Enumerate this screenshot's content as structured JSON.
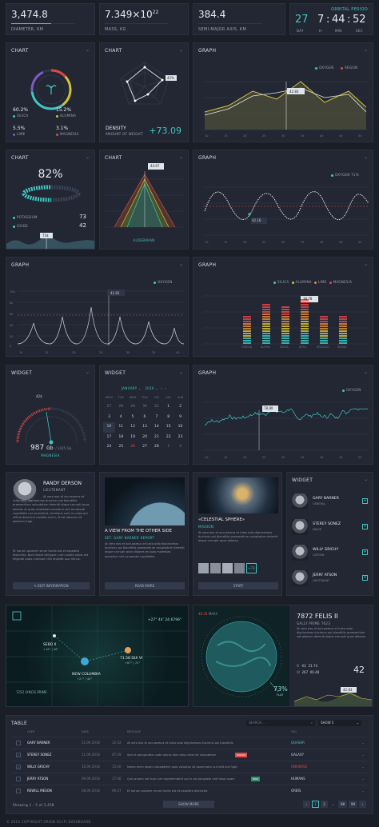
{
  "stats": [
    {
      "value": "3,474.8",
      "label": "DIAMETER, KM"
    },
    {
      "value": "7.349×10",
      "exp": "22",
      "label": "MASS, KG"
    },
    {
      "value": "384.4",
      "label": "SEMI-MAJOR AXIS, KM"
    }
  ],
  "orbital": {
    "title": "ORBITAL PERIOD",
    "d": "27",
    "h": "7",
    "m": "44",
    "s": "52",
    "dl": "DAY",
    "hl": "H",
    "ml": "MIN",
    "sl": "SEC"
  },
  "panels": {
    "chart": "CHART",
    "graph": "GRAPH",
    "widget": "WIDGET",
    "table": "TABLE"
  },
  "composition": {
    "silica": "60.2%",
    "silica_l": "SILICA",
    "alumina": "15.2%",
    "alumina_l": "ALUMINA",
    "lime": "5.5%",
    "lime_l": "LIME",
    "magnesia": "3.1%",
    "magnesia_l": "MAGNESIA"
  },
  "density": {
    "label": "DENSITY",
    "sub": "AMOUNT OF WEIGHT",
    "value": "+73.09",
    "pct": "42%"
  },
  "graph1": {
    "legend1": "OXYGEN",
    "legend2": "ARGON",
    "tip": "42.83"
  },
  "gauge82": {
    "value": "82%",
    "p_label": "POTASSIUM",
    "p_val": "73",
    "o_label": "OXIDE",
    "o_val": "42",
    "tip": "73$"
  },
  "aldebaran": {
    "label": "ALDEBARAN",
    "tip": "44.67"
  },
  "wave": {
    "legend": "OXYGEN 71%",
    "tip": "42.16"
  },
  "graph3": {
    "legend": "OXYGEN",
    "tip": "42.83",
    "ylabels": [
      "100",
      "80",
      "60",
      "40",
      "20",
      "0"
    ],
    "xlabels": [
      "10",
      "15",
      "20",
      "25",
      "30",
      "35",
      "40"
    ]
  },
  "bars": {
    "legends": [
      "SILICA",
      "ALUMINA",
      "LIME",
      "MAGNESIA"
    ],
    "tip": "38.78",
    "cats": [
      "OMEGA",
      "ALPHA",
      "DELTA",
      "ZETA",
      "EPSILON",
      "SIGMA"
    ]
  },
  "gaugeW": {
    "tip": "42$",
    "value": "987",
    "unit": "Gb",
    "sub": "/ 1425 Gb",
    "label": "MAGNESIA"
  },
  "calendar": {
    "month": "JANUARY",
    "year": "2016",
    "days": [
      "MON",
      "TUE",
      "WED",
      "THU",
      "FRI",
      "SAT",
      "SUN"
    ],
    "rows": [
      [
        "27",
        "28",
        "29",
        "30",
        "31",
        "1",
        "2"
      ],
      [
        "3",
        "4",
        "5",
        "6",
        "7",
        "8",
        "9"
      ],
      [
        "10",
        "11",
        "12",
        "13",
        "14",
        "15",
        "16"
      ],
      [
        "17",
        "18",
        "19",
        "20",
        "21",
        "22",
        "23"
      ],
      [
        "24",
        "25",
        "26",
        "27",
        "28",
        "1",
        "2"
      ]
    ]
  },
  "graph4": {
    "legend": "OXYGEN",
    "tip": "78.80"
  },
  "profile": {
    "name": "RANDY DERSON",
    "role": "LIEUTENANT",
    "bio": "At vero eos et accusamus et iusto odio dignissimos ducimus qui blanditiis praesentium voluptatum deleniti atque corrupti quos dolores et quas molestias excepturi sint occaecati cupiditate non provident, similique sunt in culpa qui officia deserunt mollitia animi, id est laborum et dolorum fuga.",
    "bio2": "Et harum quidem rerum facilis est et expedita distinctio. Nam libero tempore, cum soluta nobis est eligendi optio cumque nihil impedit quo minus.",
    "button": "EDIT INFORMATION"
  },
  "article": {
    "title": "A VIEW FROM THE OTHER SIDE",
    "meta": "SET. GARY BARNER REPORT",
    "body": "At vero eos et accusamus et iusto odio dignissimos ducimus qui blanditiis praesentium voluptatum deleniti atque corrupti quos dolores et quas molestias excepturi sint occaecati cupiditate.",
    "button": "READ MORE"
  },
  "sphere": {
    "title": "«CELESTIAL SPHERE»",
    "meta": "MISSION",
    "body": "At vero eos et accusamus et iusto odio dignissimos ducimus qui blanditiis praesentium voluptatum deleniti atque corrupti quos dolores.",
    "more": "+73",
    "button": "START"
  },
  "crew": [
    {
      "name": "GARY BARNER",
      "role": "GENERAL"
    },
    {
      "name": "STEREY SONEZ",
      "role": "MAJOR"
    },
    {
      "name": "WILLY GRICHY",
      "role": "CAPTAIN"
    },
    {
      "name": "JERRY ATSON",
      "role": "LIEUTENANT"
    }
  ],
  "map": {
    "coords": "+27° 44' 24.6796\"",
    "sebo": "SEBO II",
    "sebo_c": "+16° | 56°",
    "mol": "71.58 DUI VI",
    "mol_c": "+87° | 70°",
    "nc": "NEW COLUMBIA",
    "nc_c": "+27° | 48°",
    "lynx": "7252 LYNCIS PRIME"
  },
  "planet": {
    "badge": "48.28",
    "badge2": "MASS",
    "name": "7872 FELIS II",
    "sub": "GALLY PRIME 7623",
    "body": "At vero eos et accusamus et iusto odio dignissimos ducimus qui blanditiis praesentium voluptatum deleniti atque corrupti quos dolores.",
    "pct": "73%",
    "pct_l": "FLAT",
    "n": "N",
    "n1": "-61",
    "n2": "21.74",
    "w": "W",
    "w1": "267",
    "w2": "06.48",
    "big": "42",
    "val": "42.83"
  },
  "table": {
    "search": "SEARCH...",
    "filter": "SHOW 5",
    "cols": [
      "USER",
      "DATE",
      "",
      "MESSAGE",
      "TAG"
    ],
    "rows": [
      {
        "user": "GARY BARNER",
        "date": "12.09.2016",
        "time": "12:42",
        "msg": "At vero eos et accusamus et iusto odio dignissimos ducimus qui blanditiis",
        "badge": "",
        "tag": "QUASAR",
        "tagc": "#3fc6c0"
      },
      {
        "user": "STEREY SONEZ",
        "date": "11.09.2016",
        "time": "07:29",
        "msg": "Sed ut perspiciatis unde omnis iste natus error sit voluptatem",
        "badge": "PROMO",
        "tag": "GALAXY",
        "tagc": "#c9ced8"
      },
      {
        "user": "WILLY GRICHY",
        "date": "10.09.2016",
        "time": "15:16",
        "msg": "Nemo enim ipsam voluptatem quia voluptas sit aspernatur aut odit aut fugit",
        "badge": "",
        "tag": "UNIVERSE",
        "tagc": "#e04848"
      },
      {
        "user": "JERRY ATSON",
        "date": "09.09.2016",
        "time": "17:40",
        "msg": "Quis autem vel eum iure reprehenderit qui in ea voluptate velit esse quam",
        "badge": "NEW",
        "tag": "HUMANS",
        "tagc": "#c9ced8"
      },
      {
        "user": "REWILL MESON",
        "date": "08.09.2016",
        "time": "09:27",
        "msg": "Et harum quidem rerum facilis est et expedita distinctio",
        "badge": "",
        "tag": "ORBIS",
        "tagc": "#c9ced8"
      }
    ],
    "showing": "Showing 1 - 5 of 3,458",
    "more": "SHOW MORE",
    "pages": [
      "1",
      "2",
      "...",
      "98",
      "99"
    ]
  },
  "footer": "© 2016 COPYRIGHT ORION SCI-FI DASHBOARD"
}
